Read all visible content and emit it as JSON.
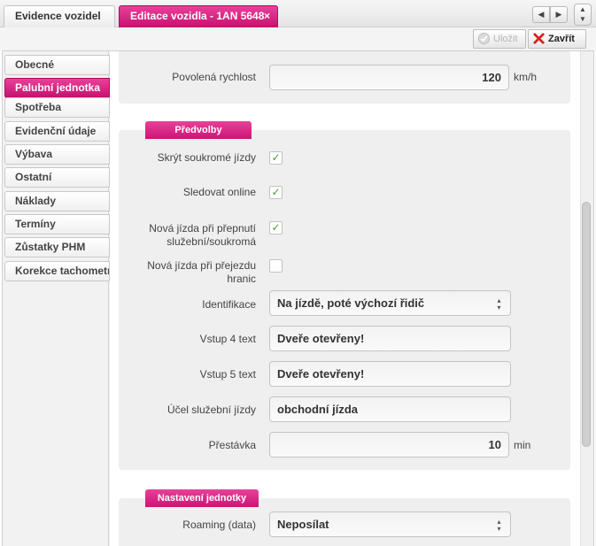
{
  "tabs": {
    "vehicles": "Evidence vozidel",
    "edit": "Editace vozidla - 1AN 5648",
    "close_glyph": "×"
  },
  "nav": {
    "left": "◀",
    "right": "▶",
    "up": "▲",
    "down": "▼"
  },
  "toolbar": {
    "save": "Uložit",
    "close": "Zavřít"
  },
  "sidebar": {
    "items": [
      "Obecné",
      "Palubní jednotka",
      "Spotřeba",
      "Evidenční údaje",
      "Výbava",
      "Ostatní",
      "Náklady",
      "Termíny",
      "Zůstatky PHM",
      "Korekce tachometru"
    ],
    "active": "Palubní jednotka"
  },
  "speed": {
    "label": "Povolená rychlost",
    "value": "120",
    "unit": "km/h"
  },
  "preferences": {
    "title": "Předvolby",
    "hide_private": {
      "label": "Skrýt soukromé jízdy",
      "checked": true,
      "mark": "✓"
    },
    "track_online": {
      "label": "Sledovat online",
      "checked": true,
      "mark": "✓"
    },
    "new_trip_switch": {
      "label_line1": "Nová jízda při přepnutí",
      "label_line2": "služební/soukromá",
      "checked": true,
      "mark": "✓"
    },
    "new_trip_border": {
      "label_line1": "Nová jízda při přejezdu",
      "label_line2": "hranic",
      "checked": false
    },
    "identification": {
      "label": "Identifikace",
      "value": "Na jízdě, poté výchozí řidič"
    },
    "input4": {
      "label": "Vstup 4 text",
      "value": "Dveře otevřeny!"
    },
    "input5": {
      "label": "Vstup 5 text",
      "value": "Dveře otevřeny!"
    },
    "purpose": {
      "label": "Účel služební jízdy",
      "value": "obchodní jízda"
    },
    "break": {
      "label": "Přestávka",
      "value": "10",
      "unit": "min"
    }
  },
  "unit_settings": {
    "title": "Nastavení jednotky",
    "roaming": {
      "label": "Roaming (data)",
      "value": "Neposílat"
    }
  },
  "colors": {
    "accent": "#d81b7f",
    "check": "#4c9a2a"
  },
  "icons": {
    "save": "check-circle-icon",
    "close": "red-x-icon"
  }
}
